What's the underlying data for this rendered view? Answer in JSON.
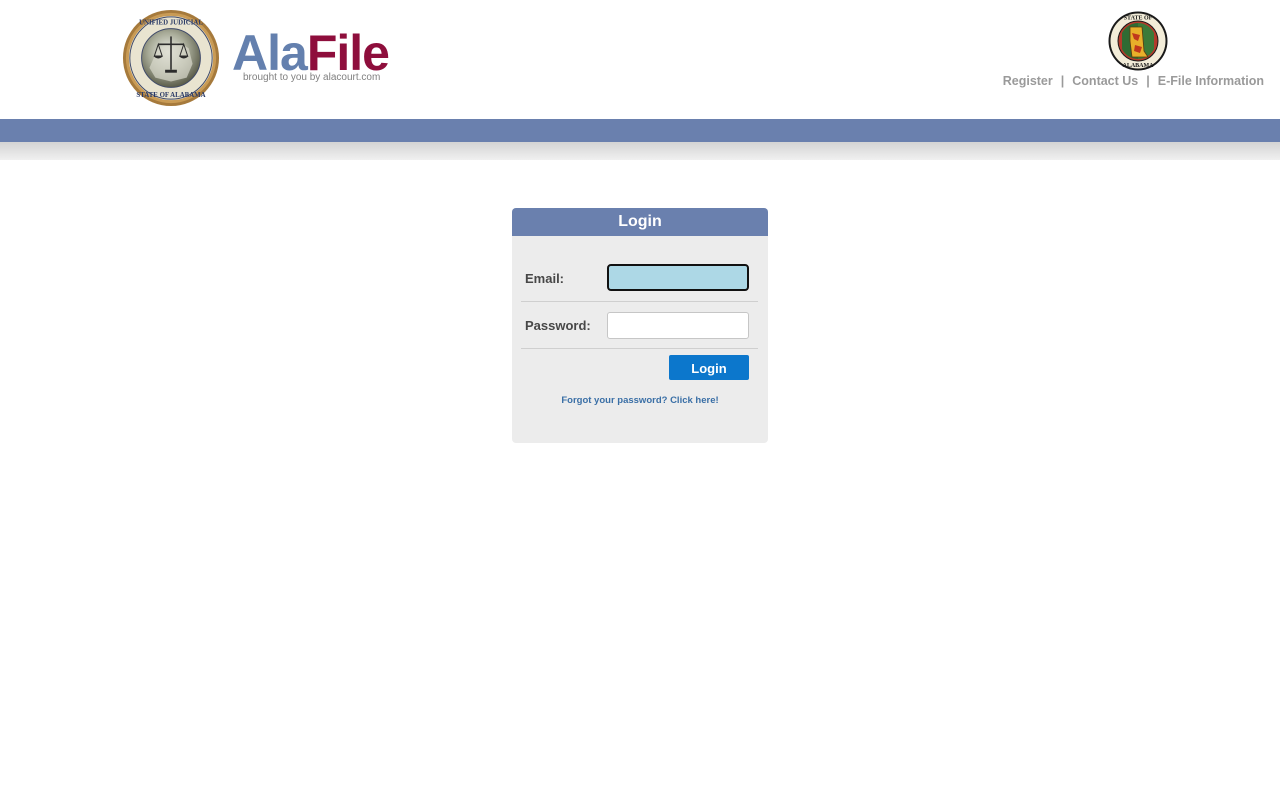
{
  "header": {
    "brand_ala": "Ala",
    "brand_file": "File",
    "brand_tagline": "brought to you by alacourt.com",
    "links": [
      "Register",
      "Contact Us",
      "E-File Information"
    ],
    "separator": "|",
    "logo_seal_icon": "unified-judicial-system-seal-icon",
    "state_seal_icon": "state-of-alabama-seal-icon"
  },
  "login": {
    "title": "Login",
    "email_label": "Email:",
    "email_value": "",
    "password_label": "Password:",
    "password_value": "",
    "submit_label": "Login",
    "forgot_link": "Forgot your password? Click here!"
  },
  "colors": {
    "brand_blue": "#6480ae",
    "brand_maroon": "#8e0e3c",
    "header_bar": "#6a80ae",
    "login_button": "#0c77cc",
    "email_focus_bg": "#add8e6",
    "panel_bg": "#ececec"
  }
}
